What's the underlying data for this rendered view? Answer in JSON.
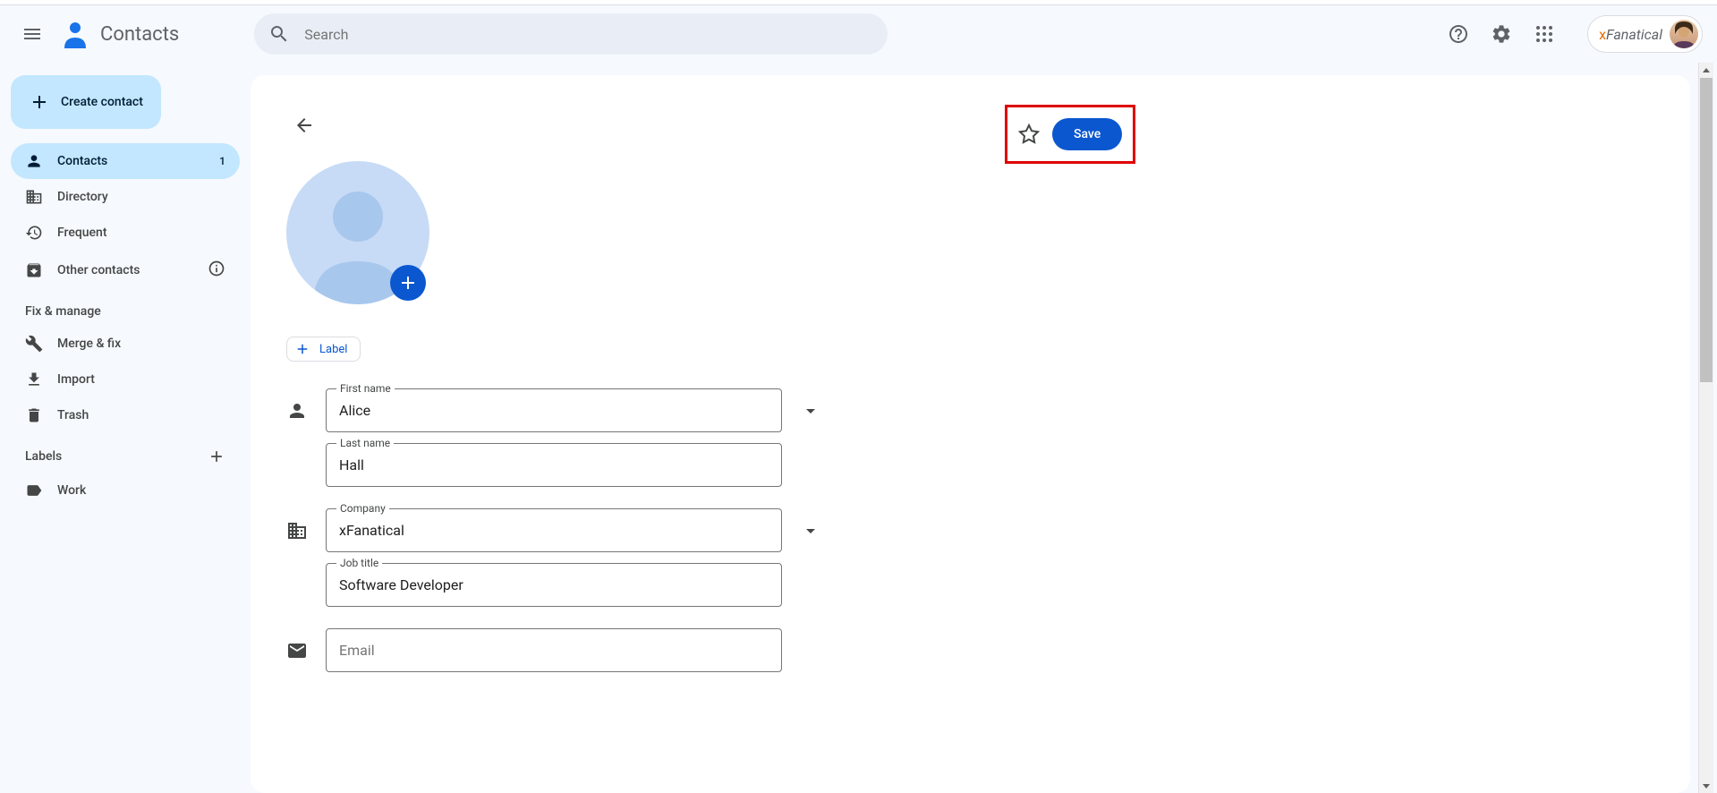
{
  "header": {
    "app_title": "Contacts",
    "search_placeholder": "Search",
    "brand_text": "Fanatical"
  },
  "sidebar": {
    "create_label": "Create contact",
    "nav": {
      "contacts": {
        "label": "Contacts",
        "count": "1"
      },
      "directory": {
        "label": "Directory"
      },
      "frequent": {
        "label": "Frequent"
      },
      "other": {
        "label": "Other contacts"
      }
    },
    "fix_manage_header": "Fix & manage",
    "fix_manage": {
      "merge": {
        "label": "Merge & fix"
      },
      "import": {
        "label": "Import"
      },
      "trash": {
        "label": "Trash"
      }
    },
    "labels_header": "Labels",
    "labels": {
      "work": {
        "label": "Work"
      }
    }
  },
  "contact": {
    "save_label": "Save",
    "label_button": "Label",
    "fields": {
      "first_name": {
        "label": "First name",
        "value": "Alice"
      },
      "last_name": {
        "label": "Last name",
        "value": "Hall"
      },
      "company": {
        "label": "Company",
        "value": "xFanatical"
      },
      "job_title": {
        "label": "Job title",
        "value": "Software Developer"
      },
      "email": {
        "label": "Email",
        "value": ""
      }
    }
  }
}
